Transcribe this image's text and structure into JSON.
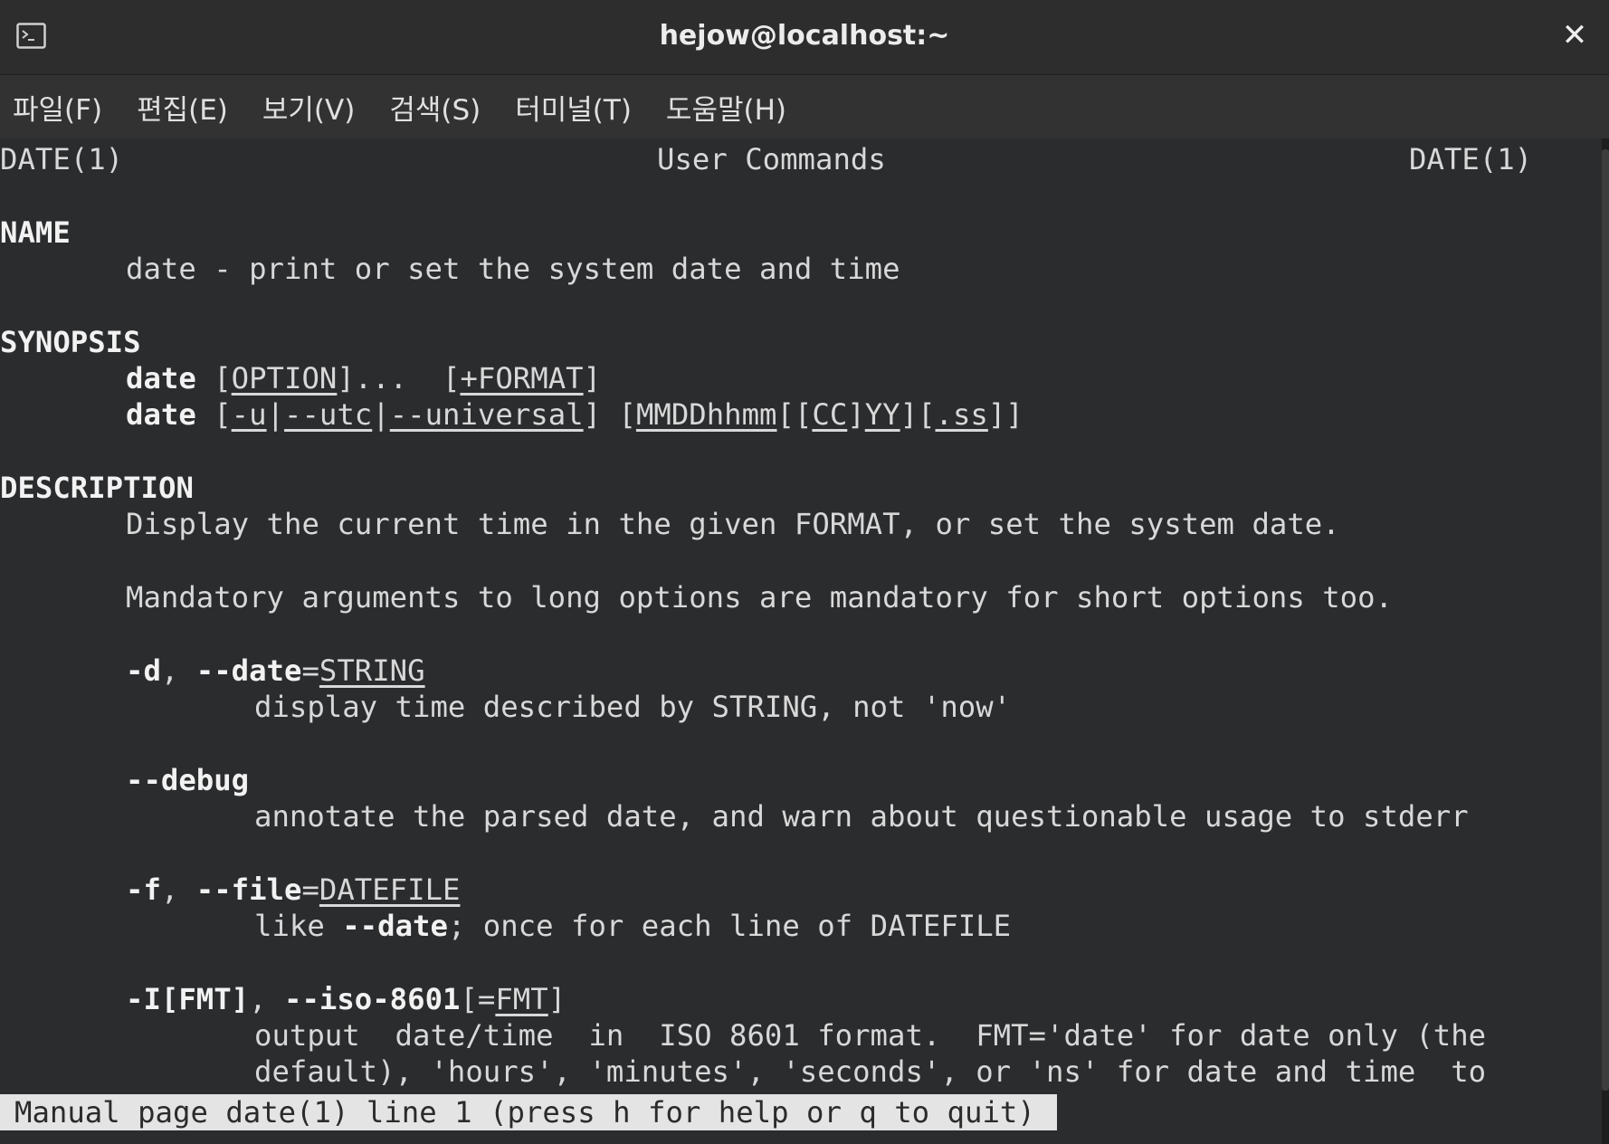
{
  "window": {
    "title": "hejow@localhost:~",
    "close_glyph": "✕"
  },
  "menu": [
    {
      "label": "파일(F)"
    },
    {
      "label": "편집(E)"
    },
    {
      "label": "보기(V)"
    },
    {
      "label": "검색(S)"
    },
    {
      "label": "터미널(T)"
    },
    {
      "label": "도움말(H)"
    }
  ],
  "man": {
    "header_left": "DATE(1)",
    "header_center": "User Commands",
    "header_right": "DATE(1)",
    "name_heading": "NAME",
    "name_line": "date - print or set the system date and time",
    "synopsis_heading": "SYNOPSIS",
    "syn1": {
      "cmd": "date",
      "p1": " [",
      "opt": "OPTION",
      "p2": "]...  [",
      "fmt": "+FORMAT",
      "p3": "]"
    },
    "syn2": {
      "cmd": "date",
      "p1": " [",
      "u": "-u",
      "sep1": "|",
      "utc": "--utc",
      "sep2": "|",
      "universal": "--universal",
      "p2": "] [",
      "mm": "MMDDhhmm",
      "p3": "[[",
      "cc": "CC",
      "p4": "]",
      "yy": "YY",
      "p5": "][",
      "ss": ".ss",
      "p6": "]]"
    },
    "description_heading": "DESCRIPTION",
    "desc1": "Display the current time in the given FORMAT, or set the system date.",
    "desc2": "Mandatory arguments to long options are mandatory for short options too.",
    "opt_d": {
      "short": "-d",
      "comma": ", ",
      "long": "--date",
      "eq": "=",
      "arg": "STRING"
    },
    "opt_d_desc": "display time described by STRING, not 'now'",
    "opt_debug": "--debug",
    "opt_debug_desc": "annotate the parsed date, and warn about questionable usage to stderr",
    "opt_f": {
      "short": "-f",
      "comma": ", ",
      "long": "--file",
      "eq": "=",
      "arg": "DATEFILE"
    },
    "opt_f_desc": {
      "pre": "like ",
      "bold": "--date",
      "post": "; once for each line of DATEFILE"
    },
    "opt_i": {
      "short": "-I[FMT]",
      "comma": ", ",
      "long": "--iso-8601",
      "p1": "[=",
      "arg": "FMT",
      "p2": "]"
    },
    "opt_i_desc1": "output  date/time  in  ISO 8601 format.  FMT='date' for date only (the",
    "opt_i_desc2": "default), 'hours', 'minutes', 'seconds', or 'ns' for date and time  to"
  },
  "status": "Manual page date(1) line 1 (press h for help or q to quit)"
}
